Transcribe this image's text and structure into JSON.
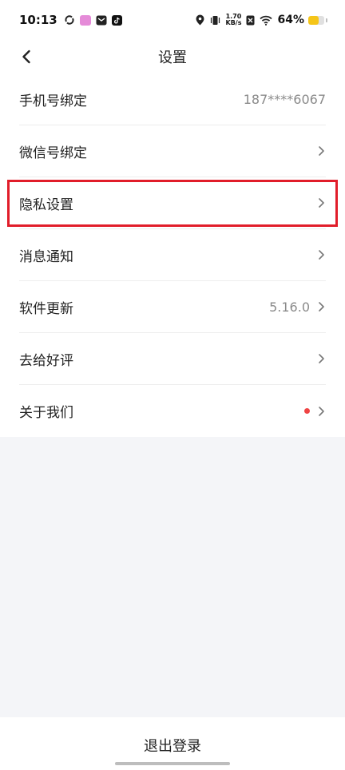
{
  "status_bar": {
    "time": "10:13",
    "net_speed_value": "1.70",
    "net_speed_unit": "KB/s",
    "battery_percent_text": "64%",
    "battery_level": 0.64
  },
  "header": {
    "title": "设置"
  },
  "settings": [
    {
      "label": "手机号绑定",
      "value": "187****6067"
    },
    {
      "label": "微信号绑定",
      "value": ""
    },
    {
      "label": "隐私设置",
      "value": ""
    },
    {
      "label": "消息通知",
      "value": ""
    },
    {
      "label": "软件更新",
      "value": "5.16.0"
    },
    {
      "label": "去给好评",
      "value": ""
    },
    {
      "label": "关于我们",
      "value": ""
    }
  ],
  "footer": {
    "logout_label": "退出登录"
  },
  "colors": {
    "highlight": "#e11d2a",
    "badge_dot": "#ef4444",
    "battery": "#f5c518"
  }
}
